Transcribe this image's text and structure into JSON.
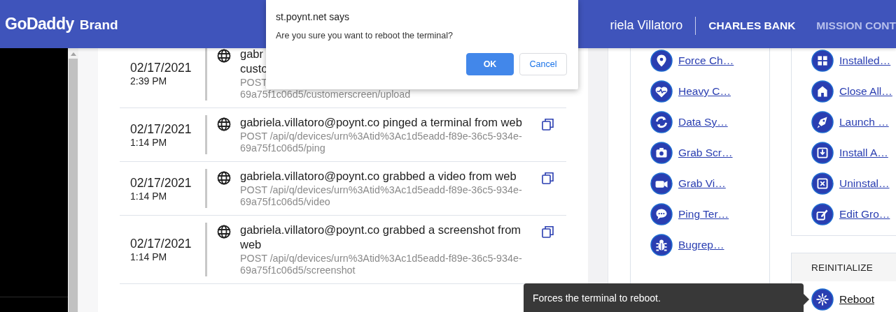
{
  "header": {
    "logo": "GoDaddy",
    "brand": "Brand",
    "user": "riela Villatoro",
    "nav": [
      {
        "label": "CHARLES BANK",
        "selected": true
      },
      {
        "label": "MISSION CONT",
        "selected": false
      }
    ]
  },
  "log": {
    "rows": [
      {
        "date": "02/17/2021",
        "time": "2:39 PM",
        "title": "gabr\ncusto",
        "path": "POST\n69a75f1c06d5/customerscreen/upload",
        "copy": false
      },
      {
        "date": "02/17/2021",
        "time": "1:14 PM",
        "title": "gabriela.villatoro@poynt.co pinged a terminal from web",
        "path": "POST /api/q/devices/urn%3Atid%3Ac1d5eadd-f89e-36c5-934e-69a75f1c06d5/ping",
        "copy": true
      },
      {
        "date": "02/17/2021",
        "time": "1:14 PM",
        "title": "gabriela.villatoro@poynt.co grabbed a video from web",
        "path": "POST /api/q/devices/urn%3Atid%3Ac1d5eadd-f89e-36c5-934e-69a75f1c06d5/video",
        "copy": true
      },
      {
        "date": "02/17/2021",
        "time": "1:14 PM",
        "title": "gabriela.villatoro@poynt.co grabbed a screenshot from web",
        "path": "POST /api/q/devices/urn%3Atid%3Ac1d5eadd-f89e-36c5-934e-69a75f1c06d5/screenshot",
        "copy": true
      }
    ]
  },
  "actions": {
    "left": [
      {
        "label": "Force Ch…"
      },
      {
        "label": "Heavy C…"
      },
      {
        "label": "Data Sy…"
      },
      {
        "label": "Grab Scr…"
      },
      {
        "label": "Grab Vi…"
      },
      {
        "label": "Ping Ter…"
      },
      {
        "label": "Bugrep…"
      }
    ],
    "right": [
      {
        "label": "Installed…"
      },
      {
        "label": "Close All…"
      },
      {
        "label": "Launch …"
      },
      {
        "label": "Install A…"
      },
      {
        "label": "Uninstal…"
      },
      {
        "label": "Edit Gro…"
      }
    ]
  },
  "reinitialize": {
    "title": "REINITIALIZE",
    "items": [
      {
        "label": "Reboot",
        "hovered": true
      }
    ]
  },
  "tooltip": {
    "text": "Forces the terminal to reboot."
  },
  "dialog": {
    "title": "st.poynt.net says",
    "message": "Are you sure you want to reboot the terminal?",
    "buttons": [
      {
        "label": "OK",
        "primary": true
      },
      {
        "label": "Cancel",
        "primary": false
      }
    ]
  }
}
